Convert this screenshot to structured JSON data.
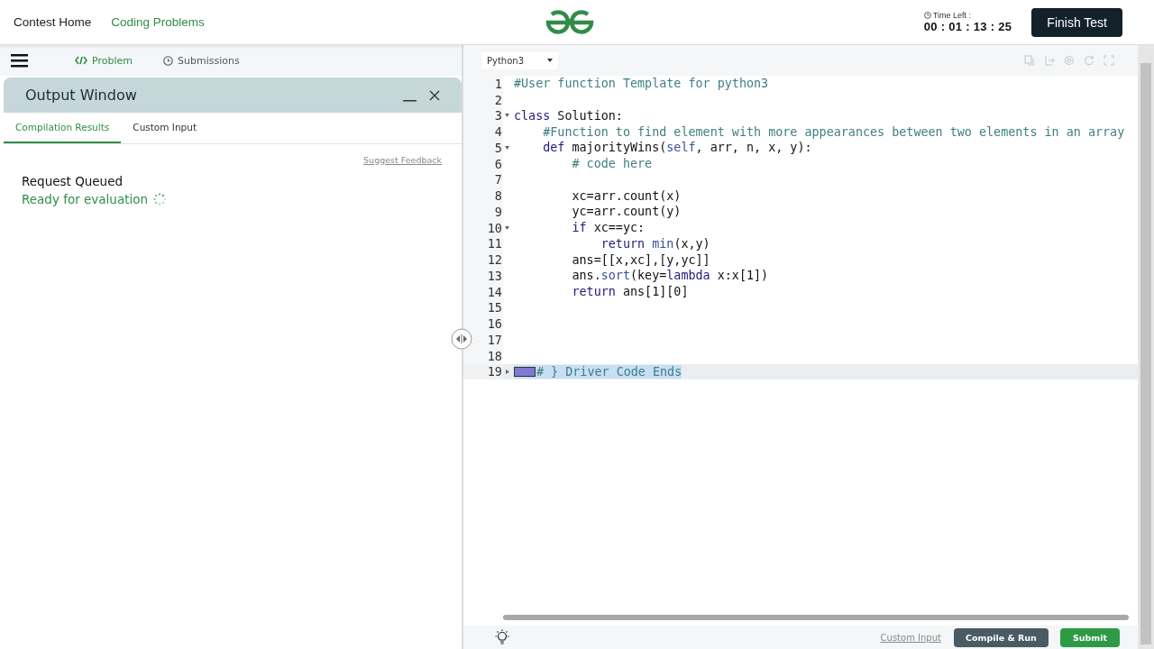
{
  "top_nav": {
    "links": [
      {
        "label": "Contest Home",
        "selected": false
      },
      {
        "label": "Coding Problems",
        "selected": true
      }
    ],
    "timer": {
      "label": "Time Left :",
      "value": "00 : 01 : 13 : 25"
    },
    "finish_button": "Finish Test"
  },
  "problem_tabs": [
    {
      "label": "Problem",
      "selected": true
    },
    {
      "label": "Submissions",
      "selected": false
    }
  ],
  "output_window": {
    "title": "Output Window",
    "tabs": [
      {
        "label": "Compilation Results",
        "selected": true
      },
      {
        "label": "Custom Input",
        "selected": false
      }
    ],
    "feedback_link": "Suggest Feedback",
    "status_title": "Request Queued",
    "status_message": "Ready for evaluation"
  },
  "editor": {
    "language": "Python3",
    "lines": [
      {
        "number": "1",
        "kind": "plain",
        "selected": false,
        "tokens": [
          {
            "t": "#User function Template for python3",
            "kind": "comment"
          }
        ]
      },
      {
        "number": "2",
        "kind": "plain",
        "selected": false
      },
      {
        "number": "3",
        "kind": "fold-start",
        "selected": false,
        "tokens": [
          {
            "t": "class",
            "kind": "keyword"
          },
          {
            "t": " Solution:",
            "kind": "plain"
          }
        ]
      },
      {
        "number": "4",
        "kind": "plain",
        "selected": false,
        "tokens": [
          {
            "t": "    #Function to find element with more appearances between two elements in an array",
            "kind": "comment"
          }
        ]
      },
      {
        "number": "5",
        "kind": "fold-start",
        "selected": false,
        "tokens": [
          {
            "t": "    def",
            "kind": "keyword"
          },
          {
            "t": " majorityWins(",
            "kind": "plain"
          },
          {
            "t": "self",
            "kind": "builtin"
          },
          {
            "t": ", arr, n, x, y):",
            "kind": "plain"
          }
        ]
      },
      {
        "number": "6",
        "kind": "plain",
        "selected": false,
        "tokens": [
          {
            "t": "        # code here",
            "kind": "comment"
          }
        ]
      },
      {
        "number": "7",
        "kind": "plain",
        "selected": false
      },
      {
        "number": "8",
        "kind": "plain",
        "selected": false,
        "tokens": [
          {
            "t": "        xc=arr.count(x)",
            "kind": "plain"
          }
        ]
      },
      {
        "number": "9",
        "kind": "plain",
        "selected": false,
        "tokens": [
          {
            "t": "        yc=arr.count(y)",
            "kind": "plain"
          }
        ]
      },
      {
        "number": "10",
        "kind": "fold-start",
        "selected": false,
        "tokens": [
          {
            "t": "        if",
            "kind": "keyword"
          },
          {
            "t": " xc==yc:",
            "kind": "plain"
          }
        ]
      },
      {
        "number": "11",
        "kind": "plain",
        "selected": false,
        "tokens": [
          {
            "t": "            return",
            "kind": "keyword"
          },
          {
            "t": " min",
            "kind": "builtin"
          },
          {
            "t": "(x,y)",
            "kind": "plain"
          }
        ]
      },
      {
        "number": "12",
        "kind": "plain",
        "selected": false,
        "tokens": [
          {
            "t": "        ans=[[x,xc],[y,yc]]",
            "kind": "plain"
          }
        ]
      },
      {
        "number": "13",
        "kind": "plain",
        "selected": false,
        "tokens": [
          {
            "t": "        ans.",
            "kind": "plain"
          },
          {
            "t": "sort",
            "kind": "builtin"
          },
          {
            "t": "(key=",
            "kind": "plain"
          },
          {
            "t": "lambda",
            "kind": "keyword"
          },
          {
            "t": " x:x[1])",
            "kind": "plain"
          }
        ]
      },
      {
        "number": "14",
        "kind": "plain",
        "selected": false,
        "tokens": [
          {
            "t": "        return",
            "kind": "keyword"
          },
          {
            "t": " ans[1][0]",
            "kind": "plain"
          }
        ]
      },
      {
        "number": "15",
        "kind": "plain",
        "selected": false
      },
      {
        "number": "16",
        "kind": "plain",
        "selected": false
      },
      {
        "number": "17",
        "kind": "plain",
        "selected": false
      },
      {
        "number": "18",
        "kind": "plain",
        "selected": false
      },
      {
        "number": "19",
        "kind": "folded",
        "selected": true,
        "tokens": [
          {
            "t": "# } Driver Code Ends",
            "kind": "comment"
          }
        ]
      }
    ]
  },
  "footer": {
    "custom_input_link": "Custom Input",
    "compile_button": "Compile & Run",
    "submit_button": "Submit"
  }
}
